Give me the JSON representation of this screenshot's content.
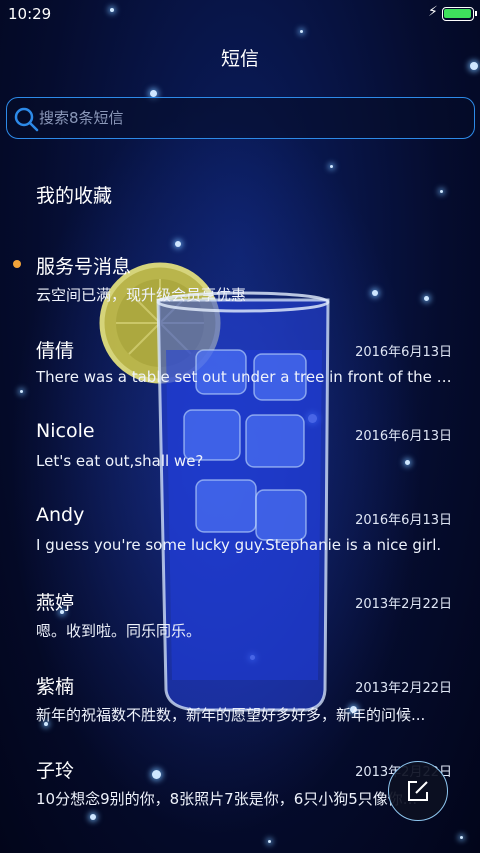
{
  "status_bar": {
    "time": "10:29",
    "battery_level": 1.0,
    "charging": true
  },
  "header": {
    "title": "短信"
  },
  "search": {
    "placeholder": "搜索8条短信"
  },
  "favorites": {
    "label": "我的收藏"
  },
  "conversations": [
    {
      "name": "服务号消息",
      "date": "",
      "snippet": "云空间已满，现升级会员享优惠",
      "unread": true
    },
    {
      "name": "倩倩",
      "date": "2016年6月13日",
      "snippet": "There was a table set out under a tree in front of the ho...",
      "unread": false
    },
    {
      "name": "Nicole",
      "date": "2016年6月13日",
      "snippet": "Let's eat out,shall we?",
      "unread": false
    },
    {
      "name": "Andy",
      "date": "2016年6月13日",
      "snippet": "I guess you're some lucky guy.Stephanie is a nice girl.",
      "unread": false
    },
    {
      "name": "燕婷",
      "date": "2013年2月22日",
      "snippet": "嗯。收到啦。同乐同乐。",
      "unread": false
    },
    {
      "name": "紫楠",
      "date": "2013年2月22日",
      "snippet": "新年的祝福数不胜数，新年的愿望好多好多，新年的问候...",
      "unread": false
    },
    {
      "name": "子玲",
      "date": "2013年2月22日",
      "snippet": "10分想念9别的你，8张照片7张是你，6只小狗5只像你...",
      "unread": false
    }
  ],
  "compose": {
    "icon": "compose-icon"
  },
  "colors": {
    "accent": "#2d8ae8",
    "unread_dot": "#f2a43a",
    "battery": "#3ee05c"
  }
}
